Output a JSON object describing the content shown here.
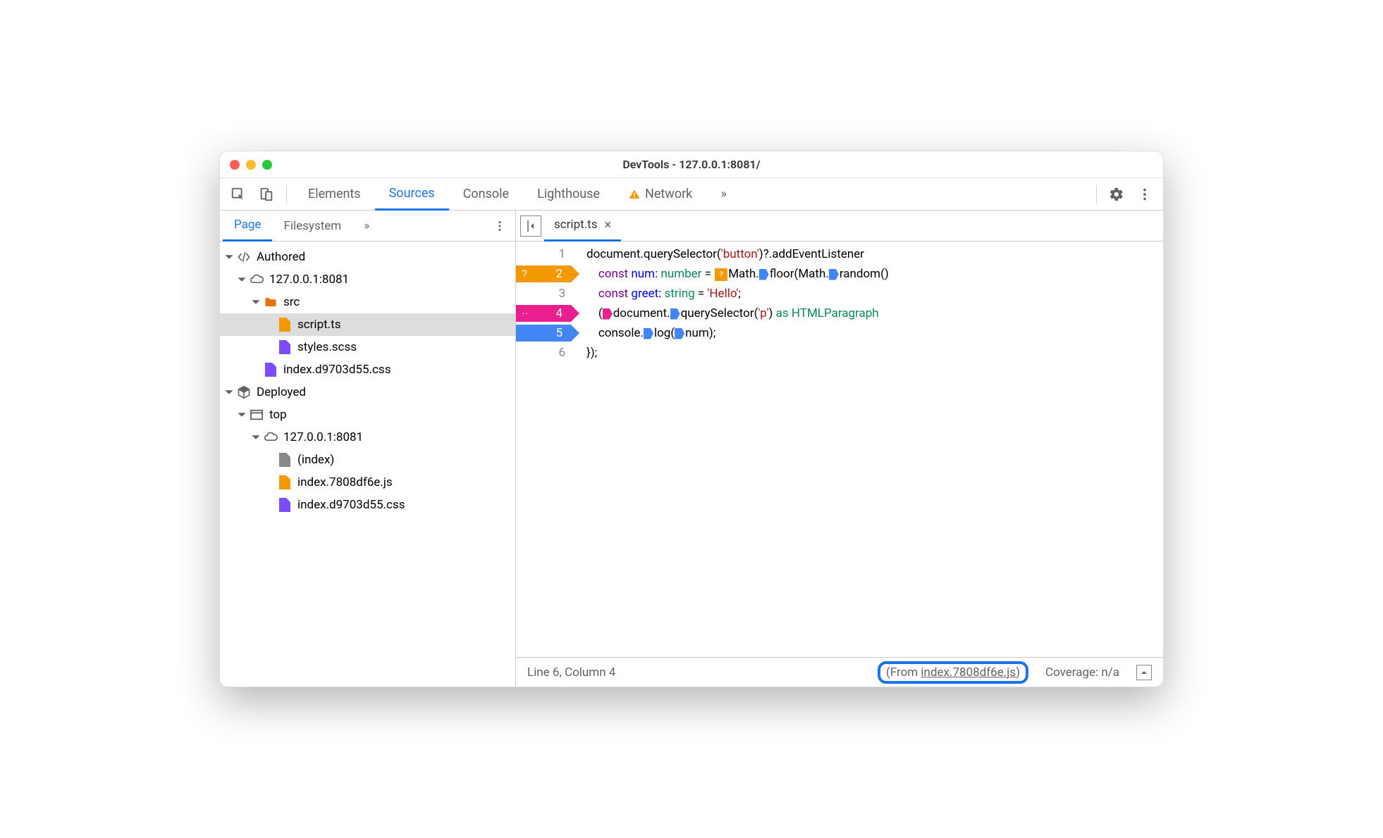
{
  "window": {
    "title": "DevTools - 127.0.0.1:8081/"
  },
  "toolbar": {
    "tabs": [
      "Elements",
      "Sources",
      "Console",
      "Lighthouse",
      "Network"
    ],
    "active": "Sources",
    "overflow": "»"
  },
  "sidebar": {
    "tabs": [
      "Page",
      "Filesystem"
    ],
    "active": "Page",
    "overflow": "»",
    "tree": {
      "authored": {
        "label": "Authored",
        "host": "127.0.0.1:8081",
        "src_folder": "src",
        "files": [
          "script.ts",
          "styles.scss"
        ],
        "css_file": "index.d9703d55.css"
      },
      "deployed": {
        "label": "Deployed",
        "top": "top",
        "host": "127.0.0.1:8081",
        "files": [
          "(index)",
          "index.7808df6e.js",
          "index.d9703d55.css"
        ]
      }
    }
  },
  "editor": {
    "open_file": "script.ts",
    "lines": [
      {
        "n": 1
      },
      {
        "n": 2,
        "bp": "orange",
        "bp_label": "?"
      },
      {
        "n": 3
      },
      {
        "n": 4,
        "bp": "pink",
        "bp_label": "··"
      },
      {
        "n": 5,
        "bp": "blue"
      },
      {
        "n": 6
      }
    ]
  },
  "status": {
    "cursor": "Line 6, Column 4",
    "from_prefix": "(From ",
    "from_link": "index.7808df6e.js",
    "from_suffix": ")",
    "coverage": "Coverage: n/a"
  }
}
